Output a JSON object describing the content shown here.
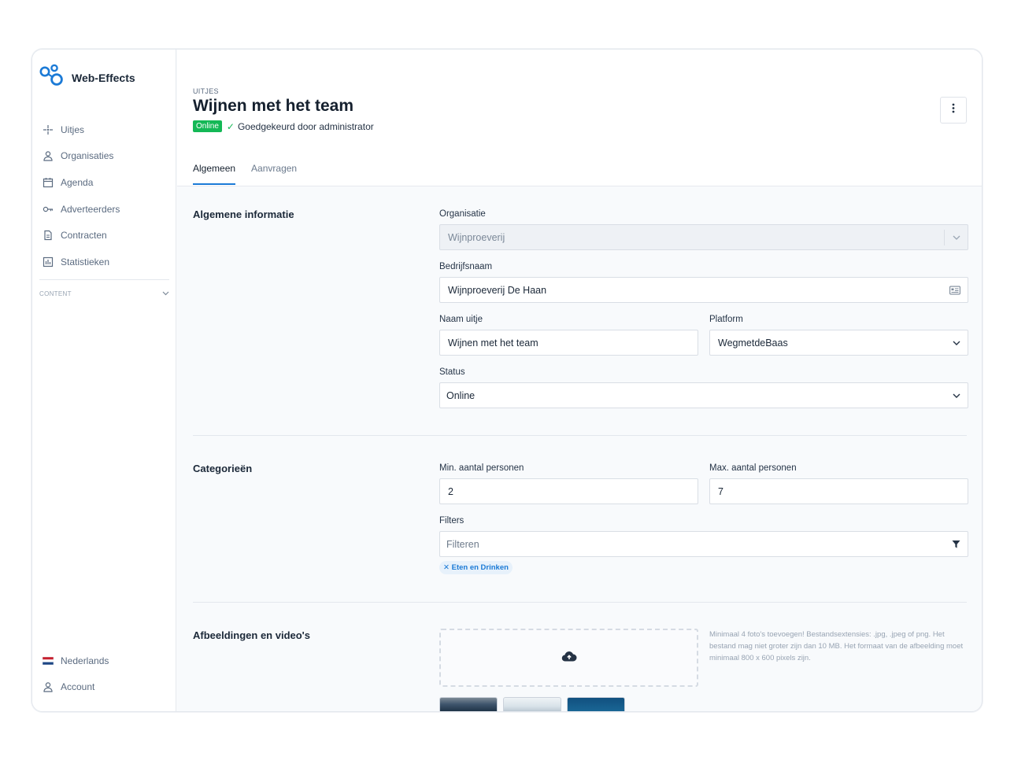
{
  "brand": {
    "name": "Web-Effects",
    "icon": "bubbles-logo-icon"
  },
  "sidebar": {
    "items": [
      {
        "label": "Uitjes",
        "icon": "sparkle-icon"
      },
      {
        "label": "Organisaties",
        "icon": "user-icon"
      },
      {
        "label": "Agenda",
        "icon": "calendar-icon"
      },
      {
        "label": "Adverteerders",
        "icon": "key-icon"
      },
      {
        "label": "Contracten",
        "icon": "document-icon"
      },
      {
        "label": "Statistieken",
        "icon": "bar-chart-icon"
      }
    ],
    "section_label": "CONTENT",
    "bottom": [
      {
        "label": "Nederlands",
        "icon": "flag-nl-icon"
      },
      {
        "label": "Account",
        "icon": "user-icon"
      }
    ]
  },
  "header": {
    "breadcrumb": "UITJES",
    "title": "Wijnen met het team",
    "status_badge": "Online",
    "approval_text": "Goedgekeurd door administrator",
    "tabs": [
      "Algemeen",
      "Aanvragen"
    ]
  },
  "general": {
    "section_title": "Algemene informatie",
    "organisatie_label": "Organisatie",
    "organisatie_value": "Wijnproeverij",
    "bedrijfsnaam_label": "Bedrijfsnaam",
    "bedrijfsnaam_value": "Wijnproeverij De Haan",
    "naam_label": "Naam uitje",
    "naam_value": "Wijnen met het team",
    "platform_label": "Platform",
    "platform_value": "WegmetdeBaas",
    "status_label": "Status",
    "status_value": "Online"
  },
  "categories": {
    "section_title": "Categorieën",
    "min_label": "Min. aantal personen",
    "min_value": "2",
    "max_label": "Max. aantal personen",
    "max_value": "7",
    "filters_label": "Filters",
    "filters_placeholder": "Filteren",
    "chip_label": "Eten en Drinken"
  },
  "media": {
    "section_title": "Afbeeldingen en video's",
    "help_text": "Minimaal 4 foto's toevoegen! Bestandsextensies: .jpg, .jpeg of png. Het bestand mag niet groter zijn dan 10 MB. Het formaat van de afbeelding moet minimaal 800 x 600 pixels zijn."
  },
  "colors": {
    "accent": "#1b7ad6",
    "online": "#14b856"
  }
}
